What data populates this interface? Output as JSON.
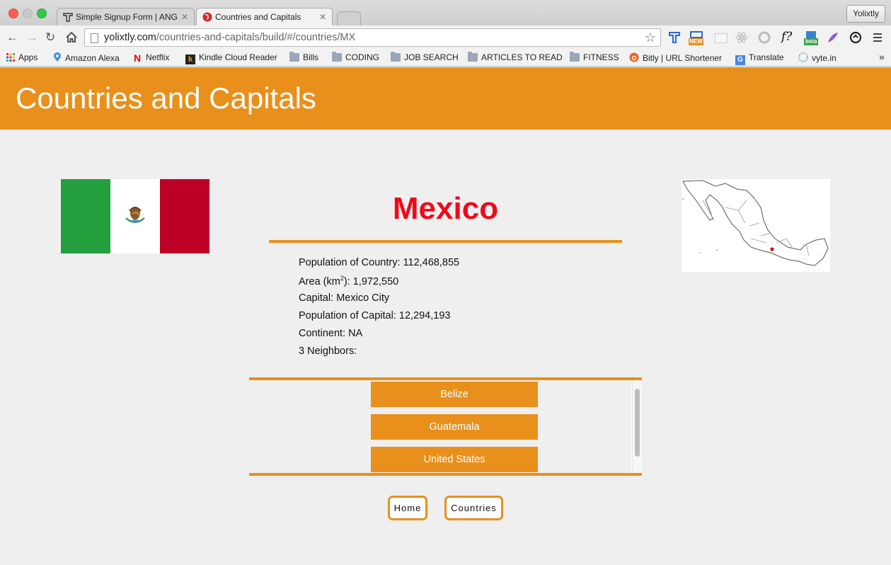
{
  "browser": {
    "tabs": [
      {
        "title": "Simple Signup Form | ANG",
        "active": false
      },
      {
        "title": "Countries and Capitals",
        "active": true
      }
    ],
    "profile_name": "Yolixtly",
    "url_domain": "yolixtly.com",
    "url_path": "/countries-and-capitals/build/#/countries/MX",
    "bookmarks": [
      {
        "label": "Apps",
        "icon": "apps-grid-icon"
      },
      {
        "label": "Amazon Alexa",
        "icon": "alexa-pin-icon"
      },
      {
        "label": "Netflix",
        "icon": "netflix-icon"
      },
      {
        "label": "Kindle Cloud Reader",
        "icon": "kindle-icon"
      },
      {
        "label": "Bills",
        "icon": "folder-icon"
      },
      {
        "label": "CODING",
        "icon": "folder-icon"
      },
      {
        "label": "JOB SEARCH",
        "icon": "folder-icon"
      },
      {
        "label": "ARTICLES TO READ",
        "icon": "folder-icon"
      },
      {
        "label": "FITNESS",
        "icon": "folder-icon"
      },
      {
        "label": "Bitly | URL Shortener",
        "icon": "bitly-icon"
      },
      {
        "label": "Translate",
        "icon": "translate-icon"
      },
      {
        "label": "vyte.in",
        "icon": "vyte-icon"
      }
    ],
    "extension_badges": {
      "new": "NEW",
      "beta": "beta",
      "fx": "f?"
    },
    "overflow": "»"
  },
  "page": {
    "header_title": "Countries and Capitals",
    "country_name": "Mexico",
    "info": {
      "population_label": "Population of Country: ",
      "population_value": "112,468,855",
      "area_label_pre": "Area (km",
      "area_sup": "2",
      "area_label_post": "): ",
      "area_value": "1,972,550",
      "capital_label": "Capital: ",
      "capital_value": "Mexico City",
      "capital_pop_label": "Population of Capital: ",
      "capital_pop_value": "12,294,193",
      "continent_label": "Continent: ",
      "continent_value": "NA",
      "neighbors_count": "3",
      "neighbors_label": " Neighbors:"
    },
    "neighbors": [
      "Belize",
      "Guatemala",
      "United States"
    ],
    "nav": {
      "home": "Home",
      "countries": "Countries"
    }
  },
  "colors": {
    "accent": "#e8901b",
    "country_title": "#ef0a1b",
    "flag_green": "#249f3e",
    "flag_red": "#be0026"
  }
}
